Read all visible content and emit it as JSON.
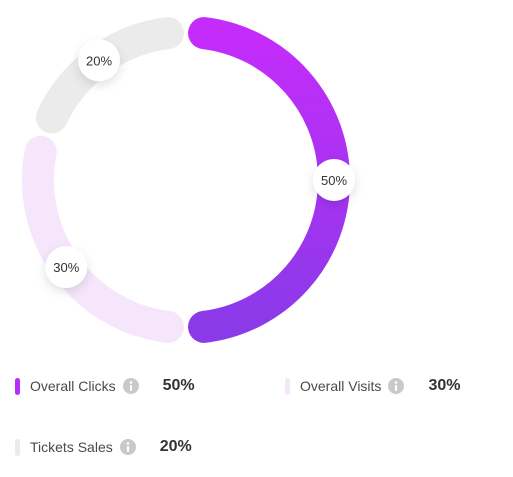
{
  "chart_data": {
    "type": "pie",
    "variant": "donut",
    "categories": [
      "Overall Clicks",
      "Overall Visits",
      "Tickets Sales"
    ],
    "values": [
      50,
      30,
      20
    ],
    "labels": [
      "50%",
      "30%",
      "20%"
    ],
    "colors": [
      "#a23ef0",
      "#f6e6fc",
      "#ebebeb"
    ],
    "gradient": {
      "Overall Clicks": [
        "#c52cfb",
        "#8a3ae8"
      ]
    },
    "legend_position": "bottom"
  },
  "legend": [
    {
      "label": "Overall Clicks",
      "value": "50%",
      "color": "#b52ef8"
    },
    {
      "label": "Overall Visits",
      "value": "30%",
      "color": "#f6e6fc"
    },
    {
      "label": "Tickets Sales",
      "value": "20%",
      "color": "#ebebeb"
    }
  ],
  "icons": {
    "info": "info-icon"
  }
}
